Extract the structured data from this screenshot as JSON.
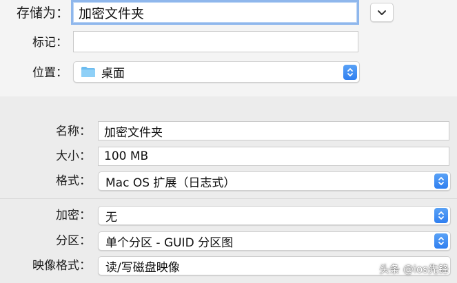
{
  "save_sheet": {
    "save_as_label": "存储为：",
    "save_as_value": "加密文件夹",
    "tags_label": "标记：",
    "tags_value": "",
    "location_label": "位置：",
    "location_value": "桌面",
    "expand_icon": "chevron-down-icon",
    "location_icon": "folder-icon"
  },
  "image_options": {
    "name_label": "名称：",
    "name_value": "加密文件夹",
    "size_label": "大小：",
    "size_value": "100 MB",
    "format_label": "格式：",
    "format_value": "Mac OS 扩展（日志式）",
    "encryption_label": "加密：",
    "encryption_value": "无",
    "partition_label": "分区：",
    "partition_value": "单个分区 - GUID 分区图",
    "image_format_label": "映像格式：",
    "image_format_value": "读/写磁盘映像"
  },
  "watermark": "头条 @ios先锋",
  "colors": {
    "accent": "#2f7ff0",
    "focus_ring": "#8fb7ec",
    "folder": "#6cbcf0"
  }
}
